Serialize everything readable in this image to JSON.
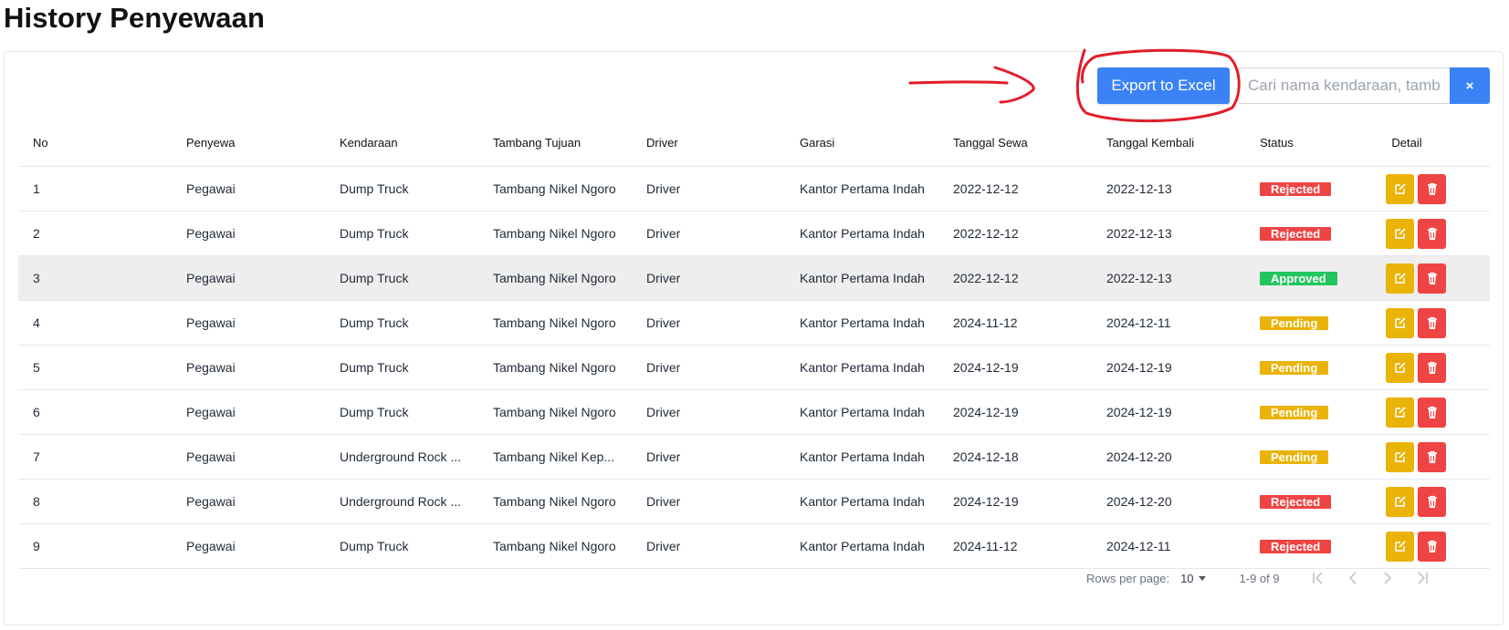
{
  "page": {
    "title": "History Penyewaan"
  },
  "toolbar": {
    "export_label": "Export to Excel",
    "search_placeholder": "Cari nama kendaraan, tambang...",
    "clear_label": "×"
  },
  "table": {
    "columns": [
      "No",
      "Penyewa",
      "Kendaraan",
      "Tambang Tujuan",
      "Driver",
      "Garasi",
      "Tanggal Sewa",
      "Tanggal Kembali",
      "Status",
      "Detail"
    ],
    "rows": [
      {
        "no": "1",
        "penyewa": "Pegawai",
        "kendaraan": "Dump Truck",
        "tambang": "Tambang Nikel Ngoro",
        "driver": "Driver",
        "garasi": "Kantor Pertama Indah",
        "tgl_sewa": "2022-12-12",
        "tgl_kembali": "2022-12-13",
        "status": "Rejected"
      },
      {
        "no": "2",
        "penyewa": "Pegawai",
        "kendaraan": "Dump Truck",
        "tambang": "Tambang Nikel Ngoro",
        "driver": "Driver",
        "garasi": "Kantor Pertama Indah",
        "tgl_sewa": "2022-12-12",
        "tgl_kembali": "2022-12-13",
        "status": "Rejected"
      },
      {
        "no": "3",
        "penyewa": "Pegawai",
        "kendaraan": "Dump Truck",
        "tambang": "Tambang Nikel Ngoro",
        "driver": "Driver",
        "garasi": "Kantor Pertama Indah",
        "tgl_sewa": "2022-12-12",
        "tgl_kembali": "2022-12-13",
        "status": "Approved"
      },
      {
        "no": "4",
        "penyewa": "Pegawai",
        "kendaraan": "Dump Truck",
        "tambang": "Tambang Nikel Ngoro",
        "driver": "Driver",
        "garasi": "Kantor Pertama Indah",
        "tgl_sewa": "2024-11-12",
        "tgl_kembali": "2024-12-11",
        "status": "Pending"
      },
      {
        "no": "5",
        "penyewa": "Pegawai",
        "kendaraan": "Dump Truck",
        "tambang": "Tambang Nikel Ngoro",
        "driver": "Driver",
        "garasi": "Kantor Pertama Indah",
        "tgl_sewa": "2024-12-19",
        "tgl_kembali": "2024-12-19",
        "status": "Pending"
      },
      {
        "no": "6",
        "penyewa": "Pegawai",
        "kendaraan": "Dump Truck",
        "tambang": "Tambang Nikel Ngoro",
        "driver": "Driver",
        "garasi": "Kantor Pertama Indah",
        "tgl_sewa": "2024-12-19",
        "tgl_kembali": "2024-12-19",
        "status": "Pending"
      },
      {
        "no": "7",
        "penyewa": "Pegawai",
        "kendaraan": "Underground Rock ...",
        "tambang": "Tambang Nikel Kep...",
        "driver": "Driver",
        "garasi": "Kantor Pertama Indah",
        "tgl_sewa": "2024-12-18",
        "tgl_kembali": "2024-12-20",
        "status": "Pending"
      },
      {
        "no": "8",
        "penyewa": "Pegawai",
        "kendaraan": "Underground Rock ...",
        "tambang": "Tambang Nikel Ngoro",
        "driver": "Driver",
        "garasi": "Kantor Pertama Indah",
        "tgl_sewa": "2024-12-19",
        "tgl_kembali": "2024-12-20",
        "status": "Rejected"
      },
      {
        "no": "9",
        "penyewa": "Pegawai",
        "kendaraan": "Dump Truck",
        "tambang": "Tambang Nikel Ngoro",
        "driver": "Driver",
        "garasi": "Kantor Pertama Indah",
        "tgl_sewa": "2024-11-12",
        "tgl_kembali": "2024-12-11",
        "status": "Rejected"
      }
    ],
    "highlighted_row": "3"
  },
  "pagination": {
    "rows_per_page_label": "Rows per page:",
    "rows_per_page_value": "10",
    "range": "1-9 of 9"
  },
  "colors": {
    "primary": "#3b82f6",
    "rejected": "#ef4444",
    "approved": "#22c55e",
    "pending": "#eab308",
    "annotation": "#e11d2a"
  }
}
